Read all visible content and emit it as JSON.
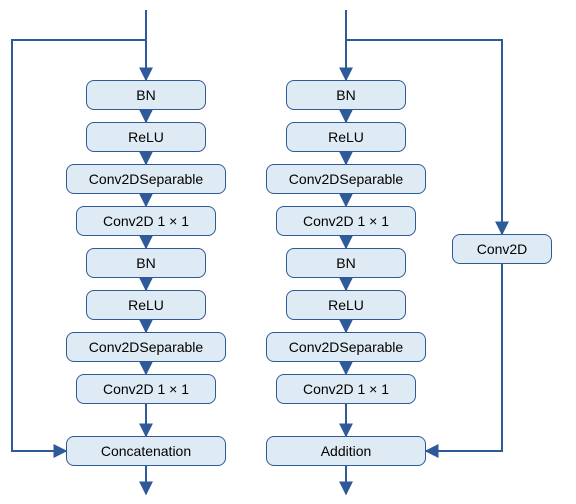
{
  "left": {
    "blocks": [
      "BN",
      "ReLU",
      "Conv2DSeparable",
      "Conv2D 1 × 1",
      "BN",
      "ReLU",
      "Conv2DSeparable",
      "Conv2D 1 × 1"
    ],
    "merge": "Concatenation"
  },
  "right": {
    "blocks": [
      "BN",
      "ReLU",
      "Conv2DSeparable",
      "Conv2D 1 × 1",
      "BN",
      "ReLU",
      "Conv2DSeparable",
      "Conv2D 1 × 1"
    ],
    "merge": "Addition",
    "side": "Conv2D"
  },
  "chart_data": {
    "type": "diagram",
    "title": "",
    "description": "Two parallel residual/dense convolutional block diagrams",
    "columns": [
      {
        "name": "left",
        "main_path": [
          "BN",
          "ReLU",
          "Conv2DSeparable",
          "Conv2D 1 × 1",
          "BN",
          "ReLU",
          "Conv2DSeparable",
          "Conv2D 1 × 1"
        ],
        "skip_from": "input",
        "skip_transform": null,
        "merge_op": "Concatenation"
      },
      {
        "name": "right",
        "main_path": [
          "BN",
          "ReLU",
          "Conv2DSeparable",
          "Conv2D 1 × 1",
          "BN",
          "ReLU",
          "Conv2DSeparable",
          "Conv2D 1 × 1"
        ],
        "skip_from": "input",
        "skip_transform": "Conv2D",
        "merge_op": "Addition"
      }
    ]
  },
  "colors": {
    "stroke": "#2e5a99",
    "fill": "#dfebf4"
  }
}
